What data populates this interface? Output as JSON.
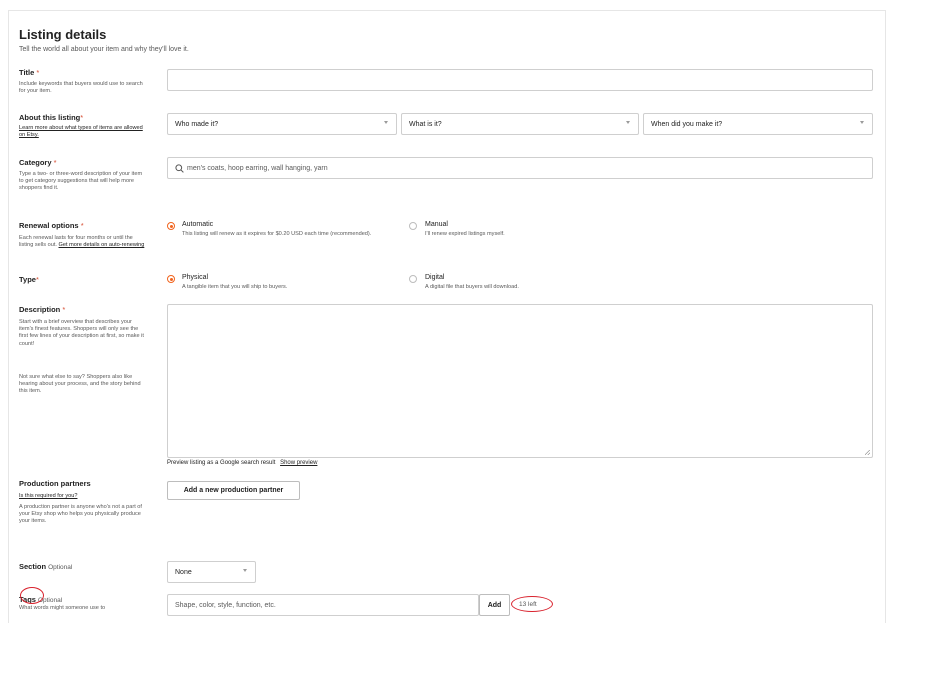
{
  "header": {
    "title": "Listing details",
    "subtitle": "Tell the world all about your item and why they'll love it."
  },
  "title_field": {
    "label": "Title",
    "required_mark": "*",
    "help": "Include keywords that buyers would use to search for your item.",
    "value": ""
  },
  "about": {
    "label": "About this listing",
    "required_mark": "*",
    "help_link": "Learn more about what types of items are allowed on Etsy.",
    "who_made": "Who made it?",
    "what_is": "What is it?",
    "when_made": "When did you make it?"
  },
  "category": {
    "label": "Category",
    "required_mark": "*",
    "help": "Type a two- or three-word description of your item to get category suggestions that will help more shoppers find it.",
    "placeholder": "men's coats, hoop earring, wall hanging, yarn",
    "icon": "search-icon"
  },
  "renewal": {
    "label": "Renewal options",
    "required_mark": "*",
    "help": "Each renewal lasts for four months or until the listing sells out.",
    "help_link": "Get more details on auto-renewing",
    "options": [
      {
        "title": "Automatic",
        "desc": "This listing will renew as it expires for $0.20 USD each time (recommended).",
        "selected": true
      },
      {
        "title": "Manual",
        "desc": "I'll renew expired listings myself.",
        "selected": false
      }
    ]
  },
  "type": {
    "label": "Type",
    "required_mark": "*",
    "options": [
      {
        "title": "Physical",
        "desc": "A tangible item that you will ship to buyers.",
        "selected": true
      },
      {
        "title": "Digital",
        "desc": "A digital file that buyers will download.",
        "selected": false
      }
    ]
  },
  "description": {
    "label": "Description",
    "required_mark": "*",
    "help1": "Start with a brief overview that describes your item's finest features. Shoppers will only see the first few lines of your description at first, so make it count!",
    "help2": "Not sure what else to say? Shoppers also like hearing about your process, and the story behind this item.",
    "value": "",
    "preview_text": "Preview listing as a Google search result",
    "preview_link": "Show preview"
  },
  "production": {
    "label": "Production partners",
    "help_link": "Is this required for you?",
    "help": "A production partner is anyone who's not a part of your Etsy shop who helps you physically produce your items.",
    "button": "Add a new production partner"
  },
  "section": {
    "label": "Section",
    "optional": "Optional",
    "value": "None"
  },
  "tags": {
    "label": "Tags",
    "optional": "Optional",
    "help": "What words might someone use to",
    "placeholder": "Shape, color, style, function, etc.",
    "add_button": "Add",
    "remaining": "13 left"
  },
  "colors": {
    "accent": "#f1641e",
    "annotation": "#d9232e",
    "required": "#d64a2e"
  }
}
